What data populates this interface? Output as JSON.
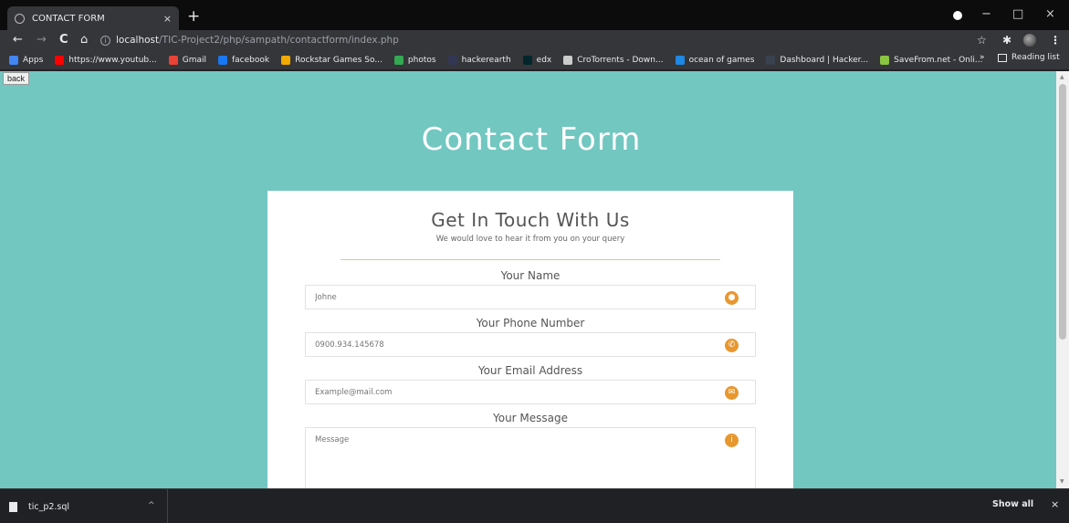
{
  "tab": {
    "title": "CONTACT FORM",
    "close": "×",
    "new_tab": "+"
  },
  "window": {
    "minimize": "−",
    "maximize": "□",
    "close": "×"
  },
  "nav": {
    "back": "←",
    "forward": "→",
    "reload": "C",
    "home": "⌂"
  },
  "address": {
    "host": "localhost",
    "path": "/TIC-Project2/php/sampath/contactform/index.php",
    "info": "i"
  },
  "toolbar_right": {
    "star": "☆",
    "extensions": "✱",
    "menu": "⋮"
  },
  "bookmarks": {
    "items": [
      {
        "label": "Apps",
        "color": "#4285f4"
      },
      {
        "label": "https://www.youtub...",
        "color": "#ff0000"
      },
      {
        "label": "Gmail",
        "color": "#ea4335"
      },
      {
        "label": "facebook",
        "color": "#1877f2"
      },
      {
        "label": "Rockstar Games So...",
        "color": "#f2a900"
      },
      {
        "label": "photos",
        "color": "#34a853"
      },
      {
        "label": "hackerearth",
        "color": "#323754"
      },
      {
        "label": "edx",
        "color": "#02262b"
      },
      {
        "label": "CroTorrents - Down...",
        "color": "#cccccc"
      },
      {
        "label": "ocean of games",
        "color": "#1e88e5"
      },
      {
        "label": "Dashboard | Hacker...",
        "color": "#39424e"
      },
      {
        "label": "SaveFrom.net - Onli...",
        "color": "#89c541"
      }
    ],
    "more": "»",
    "reading_list": "Reading list"
  },
  "page": {
    "back_button": "back",
    "title": "Contact Form",
    "card_title": "Get In Touch With Us",
    "card_subtitle": "We would love to hear it from you on your query",
    "fields": {
      "name": {
        "label": "Your Name",
        "placeholder": "Johne",
        "icon": "user-icon"
      },
      "phone": {
        "label": "Your Phone Number",
        "placeholder": "0900.934.145678",
        "icon": "phone-icon"
      },
      "email": {
        "label": "Your Email Address",
        "placeholder": "Example@mail.com",
        "icon": "mail-icon"
      },
      "message": {
        "label": "Your Message",
        "placeholder": "Message",
        "icon": "info-icon"
      }
    }
  },
  "downloads": {
    "file": "tic_p2.sql",
    "show_all": "Show all",
    "close": "×",
    "chevron": "^"
  },
  "colors": {
    "page_bg": "#72c7c1",
    "accent": "#e8972f",
    "divider": "#d9c98a"
  }
}
